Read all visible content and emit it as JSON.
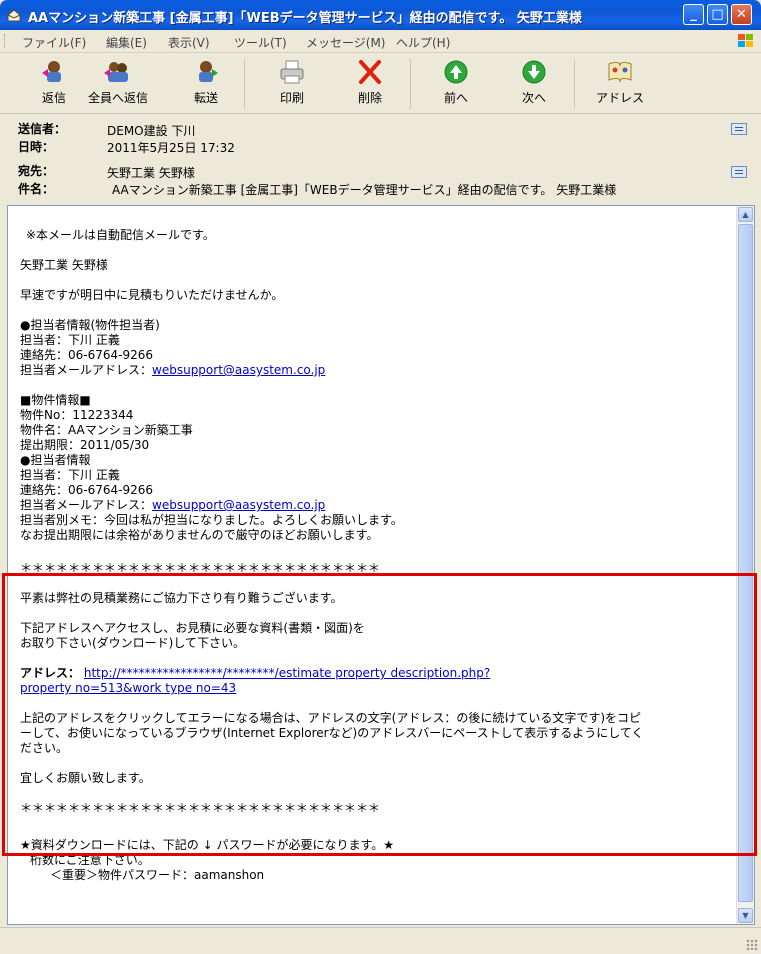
{
  "window": {
    "title": "AAマンション新築工事 [金属工事]「WEBデータ管理サービス」経由の配信です。 矢野工業様"
  },
  "menu": [
    "ファイル(F)",
    "編集(E)",
    "表示(V)",
    "ツール(T)",
    "メッセージ(M)",
    "ヘルプ(H)"
  ],
  "toolbar": {
    "reply": "返信",
    "reply_all": "全員へ返信",
    "forward": "転送",
    "print": "印刷",
    "delete": "削除",
    "previous": "前へ",
    "next": "次へ",
    "address": "アドレス"
  },
  "headers": {
    "from_label": "送信者：",
    "from_value": "DEMO建設 下川",
    "date_label": "日時：",
    "date_value": "2011年5月25日 17:32",
    "to_label": "宛先：",
    "to_value": "矢野工業 矢野様",
    "subject_label": "件名：",
    "subject_value": "AAマンション新築工事 [金属工事]「WEBデータ管理サービス」経由の配信です。 矢野工業様"
  },
  "body": {
    "auto_notice": "※本メールは自動配信メールです。",
    "greeting": "矢野工業 矢野様",
    "request": "早速ですが明日中に見積もりいただけませんか。",
    "contact_heading": "●担当者情報(物件担当者)",
    "contact_name": "担当者：下川 正義",
    "contact_phone": "連絡先：06-6764-9266",
    "contact_mail_label": "担当者メールアドレス：",
    "contact_mail": "websupport@aasystem.co.jp",
    "property_heading": "■物件情報■",
    "property_no": "物件No：11223344",
    "property_name": "物件名：AAマンション新築工事",
    "deadline": "提出期限：2011/05/30",
    "contact2_heading": "●担当者情報",
    "contact2_name": "担当者：下川 正義",
    "contact2_phone": "連絡先：06-6764-9266",
    "contact2_mail_label": "担当者メールアドレス：",
    "contact2_mail": "websupport@aasystem.co.jp",
    "memo": "担当者別メモ：今回は私が担当になりました。よろしくお願いします。",
    "deadline_note": "なお提出期限には余裕がありませんので厳守のほどお願いします。",
    "stars": "＊＊＊＊＊＊＊＊＊＊＊＊＊＊＊＊＊＊＊＊＊＊＊＊＊＊＊＊＊＊",
    "thanks": "平素は弊社の見積業務にご協力下さり有り難うございます。",
    "instruction_1": "下記アドレスへアクセスし、お見積に必要な資料(書類・図面)を",
    "instruction_2": "お取り下さい(ダウンロード)して下さい。",
    "address_label": "アドレス：",
    "address_url_1": "http://*****************/********/estimate property description.php?",
    "address_url_2": "property no=513&work type no=43",
    "error_note_1": "上記のアドレスをクリックしてエラーになる場合は、アドレスの文字(アドレス：の後に続けている文字です)をコピ",
    "error_note_2": "ーして、お使いになっているブラウザ(Internet Explorerなど)のアドレスバーにペーストして表示するようにしてく",
    "error_note_3": "ださい。",
    "regards": "宜しくお願い致します。",
    "stars2": "＊＊＊＊＊＊＊＊＊＊＊＊＊＊＊＊＊＊＊＊＊＊＊＊＊＊＊＊＊＊",
    "password_notice": "★資料ダウンロードには、下記の ↓ パスワードが必要になります。★",
    "digits_note": "桁数にご注意下さい。",
    "password_line": "＜重要＞物件パスワード：aamanshon"
  }
}
